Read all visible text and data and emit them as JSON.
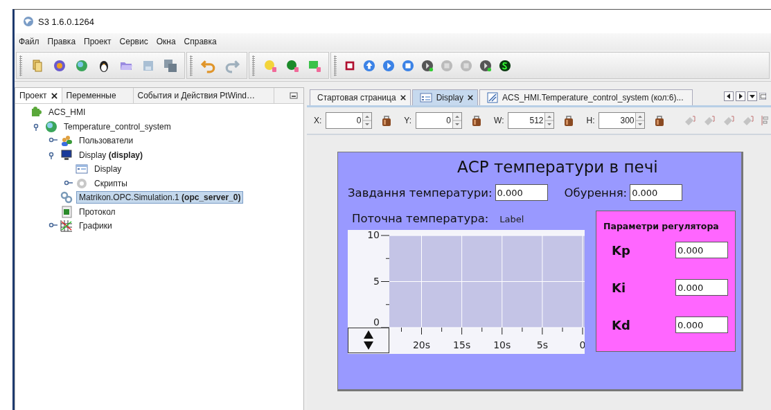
{
  "window": {
    "title": "S3 1.6.0.1264"
  },
  "menu": [
    "Файл",
    "Правка",
    "Проект",
    "Сервис",
    "Окна",
    "Справка"
  ],
  "left_tabs": [
    {
      "label": "Проект",
      "selected": true,
      "closable": true
    },
    {
      "label": "Переменные",
      "selected": false,
      "closable": false
    },
    {
      "label": "События и Действия PtWind…",
      "selected": false,
      "closable": false
    }
  ],
  "tree": [
    {
      "label": "ACS_HMI",
      "kind": "project",
      "selected": false,
      "children": [
        {
          "label": "Temperature_control_system",
          "kind": "system",
          "selected": false,
          "expanded": true,
          "children": [
            {
              "label": "Пользователи",
              "kind": "users",
              "selected": false,
              "expanded": false
            },
            {
              "label": "Display **(display)**",
              "kind": "display",
              "selected": false,
              "expanded": true,
              "children": [
                {
                  "label": "Display",
                  "kind": "screen",
                  "selected": false
                },
                {
                  "label": "Скрипты",
                  "kind": "scripts",
                  "selected": false,
                  "expanded": false
                }
              ]
            },
            {
              "label": "Matrikon.OPC.Simulation.1 **(opc_server_0)**",
              "kind": "opc",
              "selected": true
            },
            {
              "label": "Протокол",
              "kind": "protocol",
              "selected": false
            },
            {
              "label": "Графики",
              "kind": "charts",
              "selected": false,
              "expanded": false
            }
          ]
        }
      ]
    }
  ],
  "editor_tabs": [
    {
      "label": "Стартовая страница",
      "selected": false,
      "closable": true,
      "kind": "plain"
    },
    {
      "label": "Display",
      "selected": true,
      "closable": true,
      "kind": "screen"
    },
    {
      "label": "ACS_HMI.Temperature_control_system (кол:6)...",
      "selected": false,
      "closable": false,
      "kind": "chart"
    }
  ],
  "geometry": [
    {
      "label": "X:",
      "value": "0"
    },
    {
      "label": "Y:",
      "value": "0"
    },
    {
      "label": "W:",
      "value": "512"
    },
    {
      "label": "H:",
      "value": "300"
    }
  ],
  "hmi": {
    "title": "АСР температури в печі",
    "setpoint": {
      "label": "Завдання температури:",
      "value": "0.000"
    },
    "disturbance": {
      "label": "Обурення:",
      "value": "0.000"
    },
    "current": {
      "label": "Поточна температура:",
      "value": "Label"
    },
    "chart_data": {
      "type": "line",
      "grid": true,
      "ylim": [
        0,
        10
      ],
      "xlim": [
        -24,
        0
      ],
      "yticks": [
        0,
        5,
        10
      ],
      "xticks": [
        {
          "value": -20,
          "label": "20s"
        },
        {
          "value": -15,
          "label": "15s"
        },
        {
          "value": -10,
          "label": "10s"
        },
        {
          "value": -5,
          "label": "5s"
        },
        {
          "value": 0,
          "label": "0"
        }
      ]
    },
    "regulator": {
      "title": "Параметри регулятора",
      "params": [
        {
          "label": "Kp",
          "value": "0.000"
        },
        {
          "label": "Ki",
          "value": "0.000"
        },
        {
          "label": "Kd",
          "value": "0.000"
        }
      ]
    }
  }
}
